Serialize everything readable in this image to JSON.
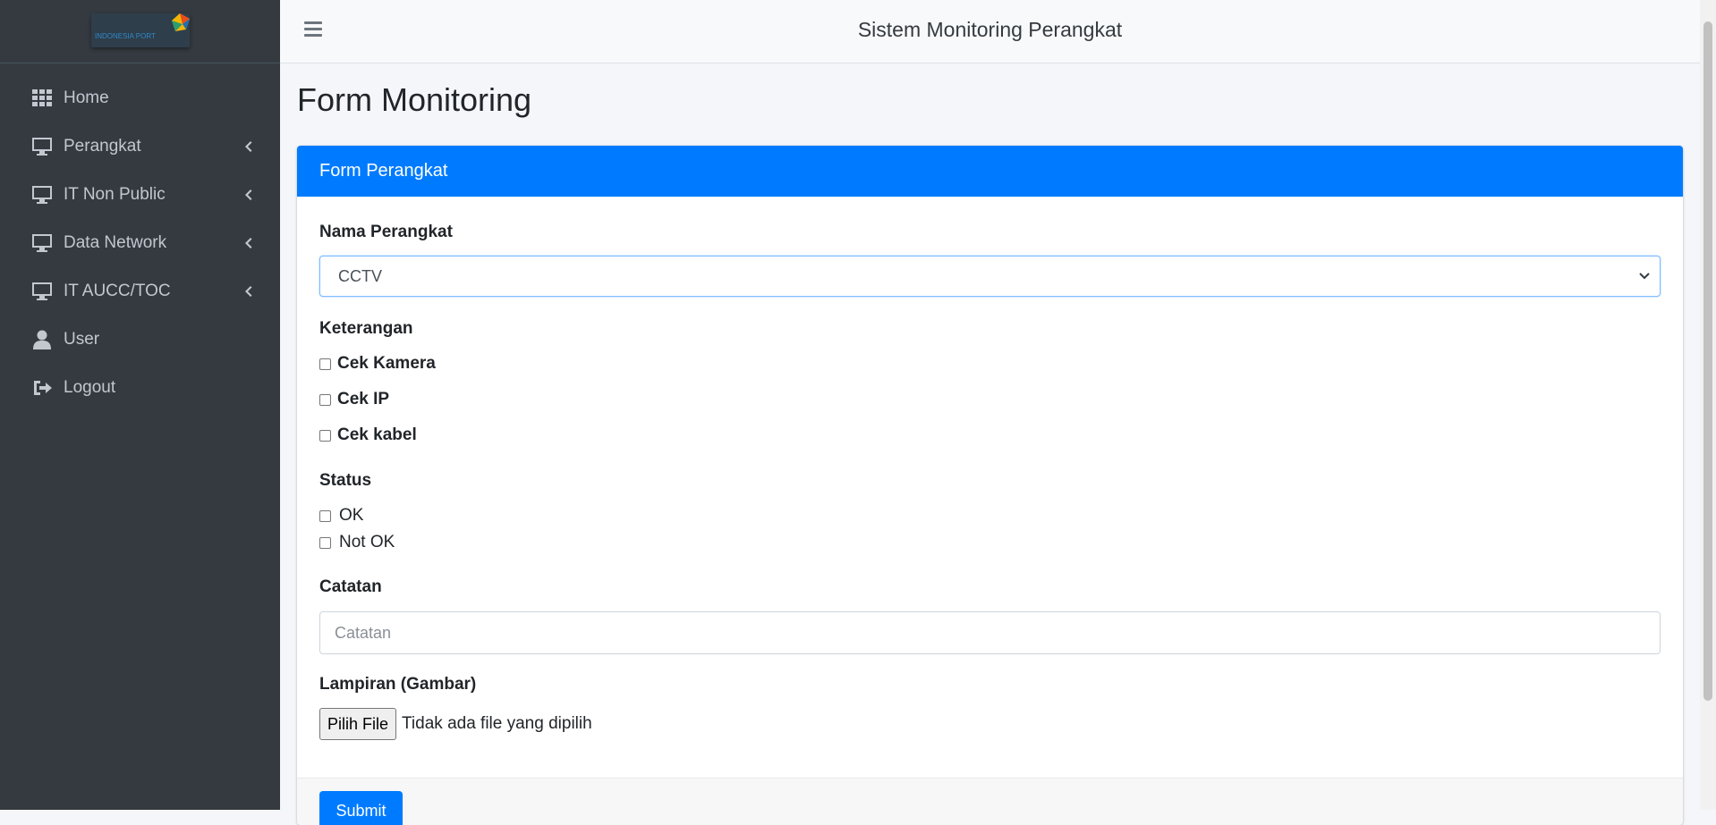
{
  "brand": {
    "logo_text": "INDONESIA PORT"
  },
  "sidebar": {
    "items": [
      {
        "label": "Home",
        "icon": "grid-icon",
        "has_submenu": false
      },
      {
        "label": "Perangkat",
        "icon": "desktop-icon",
        "has_submenu": true
      },
      {
        "label": "IT Non Public",
        "icon": "desktop-icon",
        "has_submenu": true
      },
      {
        "label": "Data Network",
        "icon": "desktop-icon",
        "has_submenu": true
      },
      {
        "label": "IT AUCC/TOC",
        "icon": "desktop-icon",
        "has_submenu": true
      },
      {
        "label": "User",
        "icon": "user-icon",
        "has_submenu": false
      },
      {
        "label": "Logout",
        "icon": "sign-out-icon",
        "has_submenu": false
      }
    ]
  },
  "header": {
    "title": "Sistem Monitoring Perangkat"
  },
  "page": {
    "title": "Form Monitoring"
  },
  "form": {
    "card_title": "Form Perangkat",
    "device": {
      "label": "Nama Perangkat",
      "selected": "CCTV"
    },
    "notes_section": {
      "label": "Keterangan",
      "options": [
        "Cek Kamera",
        "Cek IP",
        "Cek kabel"
      ]
    },
    "status": {
      "label": "Status",
      "options": [
        "OK",
        "Not OK"
      ]
    },
    "catatan": {
      "label": "Catatan",
      "placeholder": "Catatan",
      "value": ""
    },
    "attachment": {
      "label": "Lampiran (Gambar)",
      "button": "Pilih File",
      "status": "Tidak ada file yang dipilih"
    },
    "submit_label": "Submit"
  },
  "colors": {
    "sidebar_bg": "#343a40",
    "primary": "#007bff",
    "page_bg": "#f4f6f9"
  }
}
